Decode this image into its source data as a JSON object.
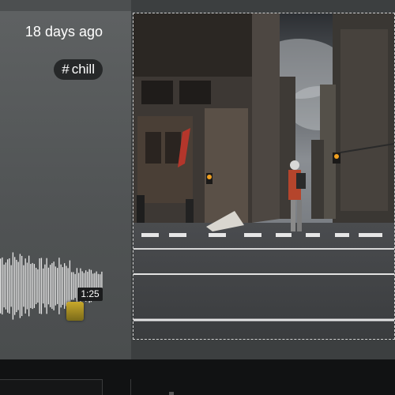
{
  "post": {
    "timestamp": "18 days ago",
    "tag": "chill",
    "tag_prefix": "#"
  },
  "audio": {
    "duration": "1:25",
    "progress": 0.72
  },
  "photo": {
    "subject": "city-street-crosswalk-photo"
  },
  "colors": {
    "chip_bg": "#262829",
    "left_panel": "#5a5d5e",
    "bottom_bar": "#111213",
    "playhead": "#c9a92b"
  }
}
